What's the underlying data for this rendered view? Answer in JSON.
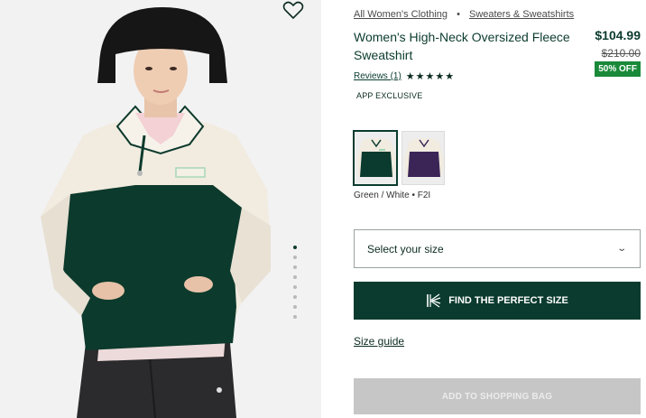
{
  "breadcrumb": {
    "items": [
      "All Women's Clothing",
      "Sweaters & Sweatshirts"
    ],
    "separator": "•"
  },
  "product": {
    "title": "Women's High-Neck Oversized Fleece Sweatshirt",
    "price": "$104.99",
    "original_price": "$210.00",
    "discount": "50% OFF",
    "reviews_label": "Reviews (1)",
    "rating": 5,
    "stars": "★★★★★",
    "tag": "APP EXCLUSIVE"
  },
  "colors": {
    "selected_label": "Green / White • F2I",
    "swatches": [
      {
        "name": "Green / White",
        "body": "#0b3b2e",
        "top": "#f1ebe0"
      },
      {
        "name": "Purple / White",
        "body": "#3a2556",
        "top": "#f1ebe0"
      }
    ]
  },
  "size": {
    "placeholder": "Select your size"
  },
  "actions": {
    "fit_label": "FIND THE PERFECT SIZE",
    "size_guide_label": "Size guide",
    "add_to_bag_label": "ADD TO SHOPPING BAG"
  },
  "gallery": {
    "image_count": 8,
    "active_index": 0
  },
  "theme": {
    "brand": "#0b3b2e",
    "sale": "#1a8a3a",
    "disabled": "#c6c6c6"
  },
  "icons": {
    "wishlist": "heart-icon",
    "fit": "kiwi-sizing-icon",
    "dropdown": "chevron-down-icon"
  }
}
